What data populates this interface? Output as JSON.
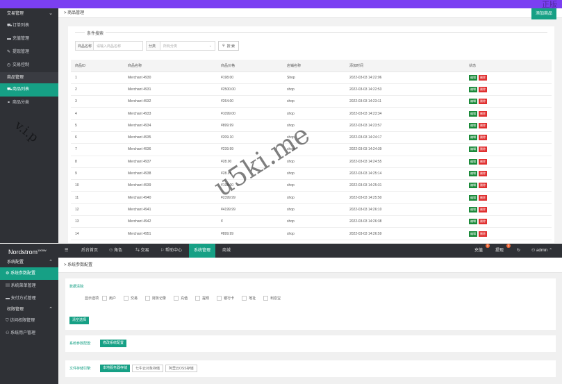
{
  "upper": {
    "sidebar": {
      "groups": [
        {
          "label": "交易管理",
          "items": [
            {
              "label": "订单列表",
              "icon": "cart-icon"
            },
            {
              "label": "充值管理",
              "icon": "card-icon"
            },
            {
              "label": "提现管理",
              "icon": "wrench-icon"
            },
            {
              "label": "交易控制",
              "icon": "clock-icon"
            }
          ]
        },
        {
          "label": "商品管理",
          "items": [
            {
              "label": "商品列表",
              "icon": "cart-icon",
              "active": true
            },
            {
              "label": "商品分类",
              "icon": "link-icon"
            }
          ]
        }
      ]
    },
    "breadcrumb": "商品管理",
    "add_button": "添加商品",
    "search": {
      "legend": "条件搜索",
      "name_label": "商品名称",
      "name_placeholder": "请输入商品名称",
      "category_label": "分类",
      "category_placeholder": "所有分类",
      "search_button": "搜 索"
    },
    "table": {
      "headers": [
        "商品ID",
        "商品名称",
        "商品价格",
        "店铺名称",
        "添加时间",
        "状态"
      ],
      "edit_label": "编辑",
      "delete_label": "删除",
      "rows": [
        [
          "1",
          "Merchant 4930",
          "¥198.00",
          "Shop",
          "2022-03-03 14:22:06"
        ],
        [
          "2",
          "Merchant 4931",
          "¥2500.00",
          "shop",
          "2022-03-03 14:22:53"
        ],
        [
          "3",
          "Merchant 4932",
          "¥264.00",
          "shop",
          "2022-03-03 14:23:11"
        ],
        [
          "4",
          "Merchant 4933",
          "¥1099.00",
          "shop",
          "2022-03-03 14:23:34"
        ],
        [
          "5",
          "Merchant 4934",
          "¥899.99",
          "shop",
          "2022-03-03 14:23:57"
        ],
        [
          "6",
          "Merchant 4935",
          "¥209.10",
          "shop",
          "2022-03-03 14:24:17"
        ],
        [
          "7",
          "Merchant 4936",
          "¥239.99",
          "shop",
          "2022-03-03 14:24:39"
        ],
        [
          "8",
          "Merchant 4937",
          "¥28.00",
          "shop",
          "2022-03-03 14:24:55"
        ],
        [
          "9",
          "Merchant 4938",
          "¥28.99",
          "shop",
          "2022-03-03 14:25:14"
        ],
        [
          "10",
          "Merchant 4939",
          "¥198.00",
          "shop",
          "2022-03-03 14:25:31"
        ],
        [
          "11",
          "Merchant 4940",
          "¥2399.99",
          "shop",
          "2022-03-03 14:25:50"
        ],
        [
          "12",
          "Merchant 4941",
          "¥4199.99",
          "shop",
          "2022-03-03 14:26:10"
        ],
        [
          "13",
          "Merchant 4942",
          "¥",
          "shop",
          "2022-03-03 14:26:38"
        ],
        [
          "14",
          "Merchant 4951",
          "¥899.99",
          "shop",
          "2022-03-03 14:26:59"
        ]
      ]
    }
  },
  "lower": {
    "brand": "Nordstrom",
    "brand_sup": "1000W",
    "nav": [
      "后台首页",
      "角色",
      "交易",
      "帮助中心",
      "系统管理",
      "商城"
    ],
    "nav_active": "系统管理",
    "recharge": "充值",
    "recharge_count": "0",
    "withdraw": "提现",
    "withdraw_count": "0",
    "user": "admin",
    "sidebar": [
      {
        "group": "系统配置",
        "items": [
          {
            "label": "系统参数配置",
            "icon": "gear-icon",
            "active": true
          },
          {
            "label": "系统菜单管理",
            "icon": "menu-icon"
          },
          {
            "label": "支付方式管理",
            "icon": "card-icon"
          }
        ]
      },
      {
        "group": "权限管理",
        "items": [
          {
            "label": "访问权限管理",
            "icon": "shield-icon"
          },
          {
            "label": "系统用户管理",
            "icon": "user-icon"
          }
        ]
      }
    ],
    "breadcrumb": "系统参数配置",
    "data_clean": {
      "title": "数据清除:",
      "options_label": "显示选项",
      "options": [
        "用户",
        "交易",
        "财务记录",
        "充值",
        "提现",
        "银行卡",
        "地址",
        "利息宝"
      ],
      "button": "清空选择"
    },
    "system_config": {
      "title": "系统参数配置:",
      "button": "修改系统配置"
    },
    "storage": {
      "title": "文件存储引擎:",
      "options": [
        "本地服务器存储",
        "七牛云对象存储",
        "阿里云OSS存储"
      ]
    }
  },
  "watermarks": [
    "u5ki.me",
    "v.i.p",
    "正版"
  ]
}
